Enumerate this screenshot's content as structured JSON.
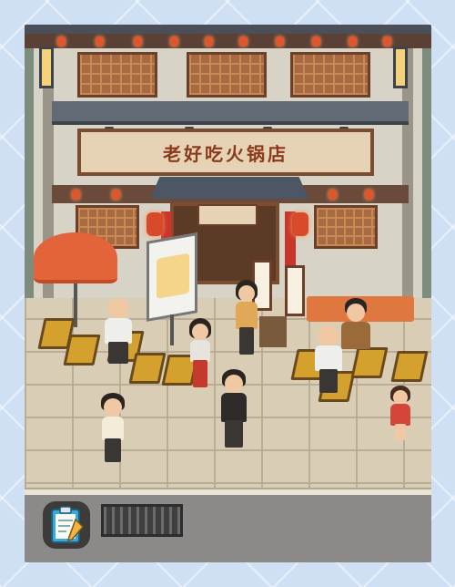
{
  "scene": {
    "shop_sign": "老好吃火锅店",
    "door_couplet_left": "",
    "door_couplet_right": ""
  },
  "hud": {
    "clipboard_button": "clipboard-icon"
  },
  "colors": {
    "sign_text": "#8a3a1c",
    "umbrella": "#e3633a",
    "chair": "#d4a12f",
    "table": "#e0773f",
    "lantern": "#d84a2a"
  }
}
